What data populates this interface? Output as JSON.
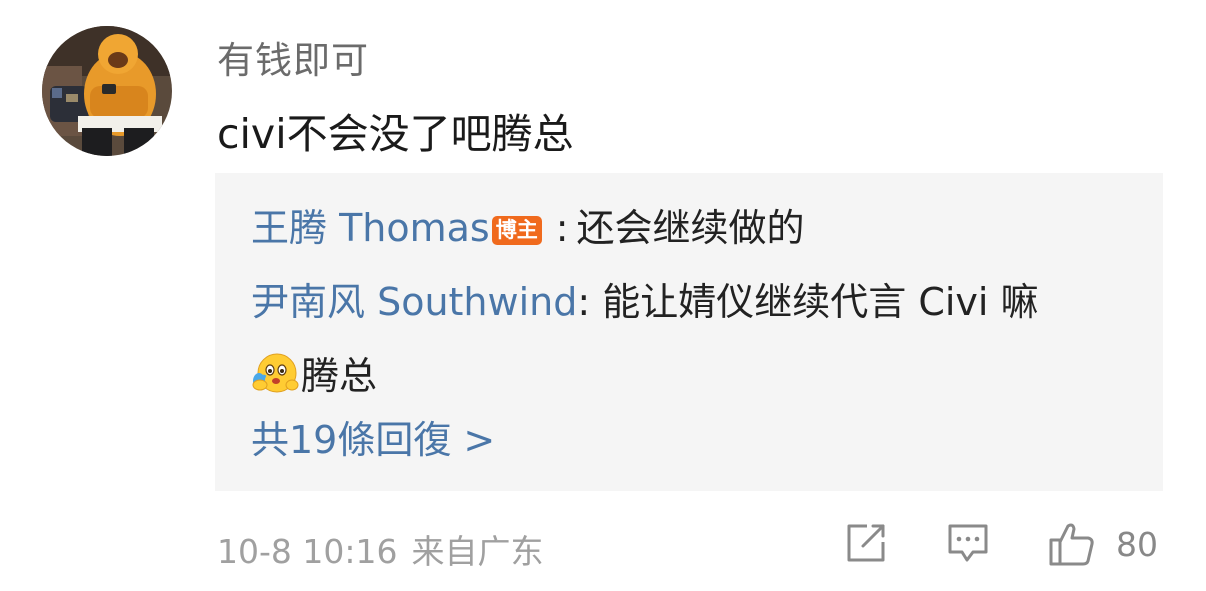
{
  "comment": {
    "username": "有钱即可",
    "text": "civi不会没了吧腾总",
    "timestamp": "10-8 10:16",
    "location": "来自广东",
    "like_count": "80"
  },
  "replies": [
    {
      "author": "王腾 Thomas",
      "badge": "博主",
      "separator": ":",
      "text": "还会继续做的"
    },
    {
      "author": "尹南风 Southwind",
      "separator": ":",
      "text": "能让婧仪继续代言 Civi 嘛",
      "text_cont": "腾总",
      "emoji": "crying-hugging-emoji"
    }
  ],
  "more_replies_label": "共19條回復 >",
  "icons": {
    "share": "share-edit-icon",
    "comment": "comment-icon",
    "like": "thumbs-up-icon"
  },
  "colors": {
    "author_link": "#4a76a8",
    "badge": "#f06a1d",
    "reply_bg": "#f5f5f5",
    "meta_text": "#a0a0a0"
  }
}
